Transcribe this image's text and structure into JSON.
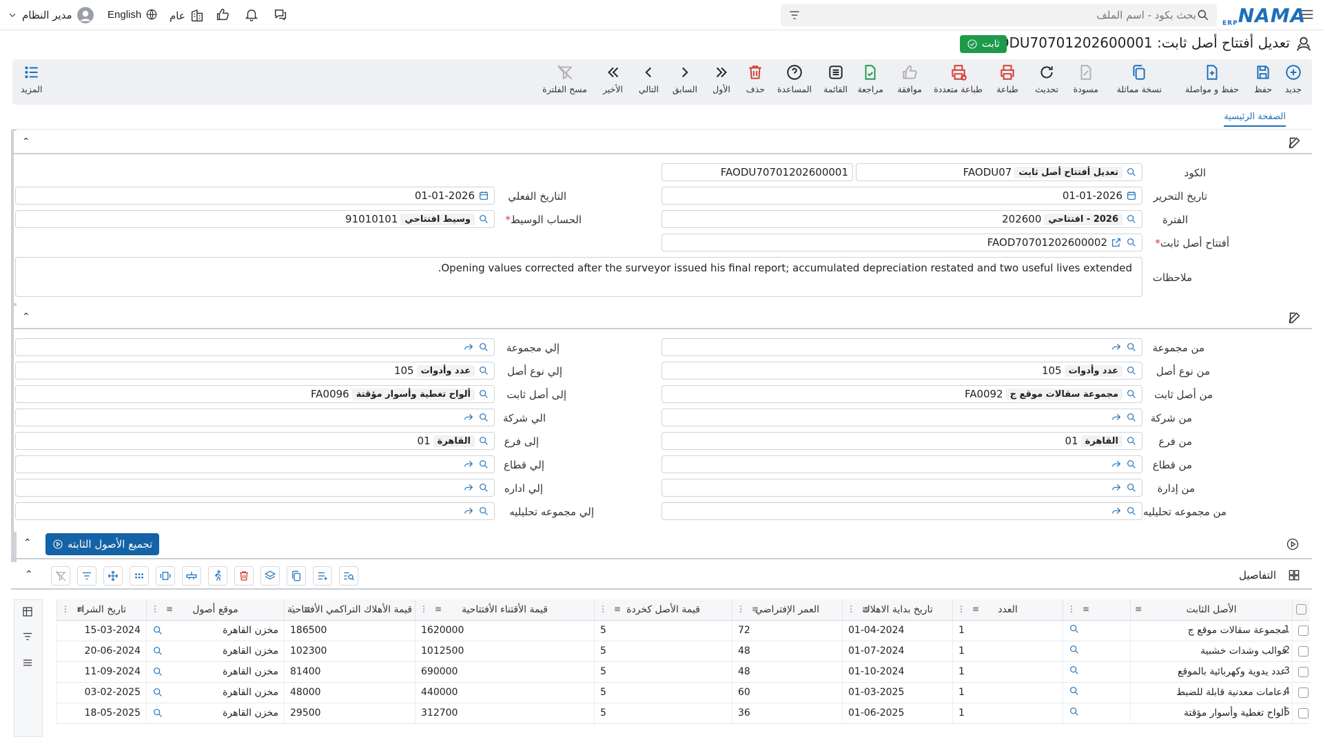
{
  "topbar": {
    "user_name": "مدير النظام",
    "language": "English",
    "scope": "عام",
    "search_placeholder": "بحث بكود - اسم الملف",
    "logo_text": "NAMA",
    "logo_sub": "ERP"
  },
  "title": {
    "text": "تعديل أفتتاح أصل ثابت: FAODU70701202600001",
    "status": "ثابت"
  },
  "toolbar": {
    "new": "جديد",
    "save": "حفظ",
    "save_continue": "حفظ و مواصلة",
    "copy": "نسخة مماثلة",
    "draft": "مسودة",
    "refresh": "تحديث",
    "print": "طباعة",
    "multi_print": "طباعة متعددة",
    "approve": "موافقة",
    "review": "مراجعة",
    "list": "القائمة",
    "help": "المساعدة",
    "delete": "حذف",
    "first": "الأول",
    "prev": "السابق",
    "next": "التالي",
    "last": "الأخير",
    "clear_filter": "مسح الفلترة",
    "more": "المزيد"
  },
  "tabs": {
    "main": "الصفحة الرئيسية"
  },
  "header_form": {
    "code_label": "الكود",
    "code_value": "FAODU07",
    "code_tag": "تعديل أفتتاح أصل ثابت",
    "doc_number": "FAODU70701202600001",
    "edit_date_label": "تاريخ التحرير",
    "edit_date": "01-01-2026",
    "actual_date_label": "التاريخ الفعلي",
    "actual_date": "01-01-2026",
    "period_label": "الفترة",
    "period_value": "202600",
    "period_tag": "2026 - افتتاحي",
    "intermediate_label": "الحساب الوسيط",
    "intermediate_value": "91010101",
    "intermediate_tag": "وسيط افتتاحي",
    "opening_label": "أفتتاح أصل ثابت",
    "opening_value": "FAOD70701202600002",
    "notes_label": "ملاحظات",
    "notes_value": "Opening values corrected after the surveyor issued his final report; accumulated depreciation restated and two useful lives extended."
  },
  "filter_form": {
    "from_group": "من مجموعة",
    "to_group": "إلي مجموعة",
    "from_type": "من نوع أصل",
    "from_type_value": "105",
    "from_type_tag": "عدد وأدوات",
    "to_type": "إلي نوع أصل",
    "to_type_value": "105",
    "to_type_tag": "عدد وأدوات",
    "from_asset": "من أصل ثابت",
    "from_asset_value": "FA0092",
    "from_asset_tag": "مجموعة سقالات موقع ج",
    "to_asset": "إلى أصل ثابت",
    "to_asset_value": "FA0096",
    "to_asset_tag": "ألواح تغطية وأسوار مؤقتة",
    "from_company": "من شركة",
    "to_company": "الي شركة",
    "from_branch": "من فرع",
    "from_branch_value": "01",
    "from_branch_tag": "القاهرة",
    "to_branch": "إلى فرع",
    "to_branch_value": "01",
    "to_branch_tag": "القاهرة",
    "from_sector": "من قطاع",
    "to_sector": "إلي قطاع",
    "from_dept": "من إدارة",
    "to_dept": "إلي اداره",
    "from_analytic": "من مجموعه تحليليه",
    "to_analytic": "إلي مجموعه تحليليه"
  },
  "collect_button": "تجميع الأصول الثابته",
  "details": {
    "title": "التفاصيل",
    "columns": [
      "الأصل الثابت",
      "العدد",
      "تاريخ بداية الاهلاك",
      "العمر الإفتراضي",
      "قيمة الأصل كخردة",
      "قيمة الأقتناء الأفتتاحية",
      "قيمة الأهلاك التراكمي الأفتتاحية",
      "موقع أصول",
      "تاريخ الشراء"
    ],
    "rows": [
      {
        "n": "1",
        "asset": "مجموعة سقالات موقع ج",
        "qty": "1",
        "start": "01-04-2024",
        "life": "72",
        "scrap": "5",
        "cost": "1620000",
        "dep": "186500",
        "loc": "مخزن القاهرة",
        "buy": "15-03-2024"
      },
      {
        "n": "2",
        "asset": "قوالب وشدات خشبية",
        "qty": "1",
        "start": "01-07-2024",
        "life": "48",
        "scrap": "5",
        "cost": "1012500",
        "dep": "102300",
        "loc": "مخزن القاهرة",
        "buy": "20-06-2024"
      },
      {
        "n": "3",
        "asset": "عدد يدوية وكهربائية بالموقع",
        "qty": "1",
        "start": "01-10-2024",
        "life": "48",
        "scrap": "5",
        "cost": "690000",
        "dep": "81400",
        "loc": "مخزن القاهرة",
        "buy": "11-09-2024"
      },
      {
        "n": "4",
        "asset": "دعامات معدنية قابلة للضبط",
        "qty": "1",
        "start": "01-03-2025",
        "life": "60",
        "scrap": "5",
        "cost": "440000",
        "dep": "48000",
        "loc": "مخزن القاهرة",
        "buy": "03-02-2025"
      },
      {
        "n": "5",
        "asset": "ألواح تغطية وأسوار مؤقتة",
        "qty": "1",
        "start": "01-06-2025",
        "life": "36",
        "scrap": "5",
        "cost": "312700",
        "dep": "29500",
        "loc": "مخزن القاهرة",
        "buy": "18-05-2025"
      }
    ]
  },
  "colors": {
    "accent": "#1d6fb8",
    "status_green": "#1e9b4a",
    "danger": "#d33b2f",
    "primary_btn": "#1463a6"
  }
}
